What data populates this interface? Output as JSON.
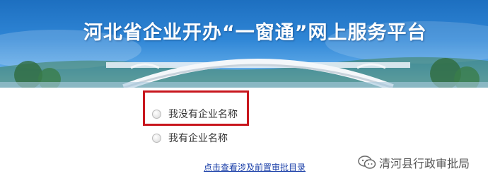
{
  "banner": {
    "title": "河北省企业开办“一窗通”网上服务平台"
  },
  "options": [
    {
      "label": "我没有企业名称",
      "selected": false,
      "highlighted": true
    },
    {
      "label": "我有企业名称",
      "selected": false,
      "highlighted": false
    }
  ],
  "link": {
    "label": "点击查看涉及前置审批目录"
  },
  "watermark": {
    "text": "清河县行政审批局",
    "icon": "wechat-icon"
  },
  "colors": {
    "banner_blue": "#1d6fc0",
    "highlight_red": "#c8161d",
    "link_blue": "#1a3fa8"
  }
}
